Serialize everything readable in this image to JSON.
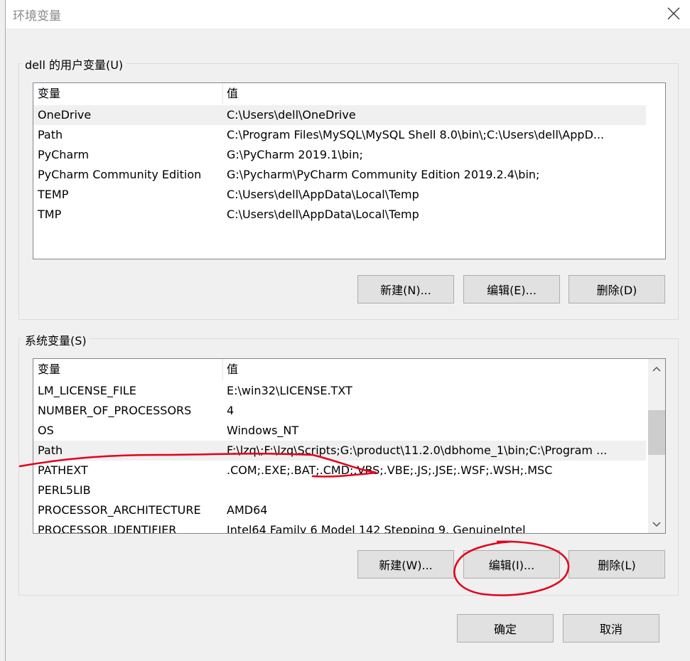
{
  "window": {
    "title": "环境变量"
  },
  "user_vars": {
    "group_label": "dell 的用户变量(U)",
    "headers": {
      "variable": "变量",
      "value": "值"
    },
    "rows": [
      {
        "variable": "OneDrive",
        "value": "C:\\Users\\dell\\OneDrive"
      },
      {
        "variable": "Path",
        "value": "C:\\Program Files\\MySQL\\MySQL Shell 8.0\\bin\\;C:\\Users\\dell\\AppD..."
      },
      {
        "variable": "PyCharm",
        "value": "G:\\PyCharm 2019.1\\bin;"
      },
      {
        "variable": "PyCharm Community Edition",
        "value": "G:\\Pycharm\\PyCharm Community Edition 2019.2.4\\bin;"
      },
      {
        "variable": "TEMP",
        "value": "C:\\Users\\dell\\AppData\\Local\\Temp"
      },
      {
        "variable": "TMP",
        "value": "C:\\Users\\dell\\AppData\\Local\\Temp"
      }
    ],
    "buttons": {
      "new": "新建(N)...",
      "edit": "编辑(E)...",
      "delete": "删除(D)"
    }
  },
  "system_vars": {
    "group_label": "系统变量(S)",
    "headers": {
      "variable": "变量",
      "value": "值"
    },
    "rows": [
      {
        "variable": "LM_LICENSE_FILE",
        "value": "E:\\win32\\LICENSE.TXT"
      },
      {
        "variable": "NUMBER_OF_PROCESSORS",
        "value": "4"
      },
      {
        "variable": "OS",
        "value": "Windows_NT"
      },
      {
        "variable": "Path",
        "value": "F:\\lzq\\;F:\\lzq\\Scripts;G:\\product\\11.2.0\\dbhome_1\\bin;C:\\Program ..."
      },
      {
        "variable": "PATHEXT",
        "value": ".COM;.EXE;.BAT;.CMD;.VBS;.VBE;.JS;.JSE;.WSF;.WSH;.MSC"
      },
      {
        "variable": "PERL5LIB",
        "value": ""
      },
      {
        "variable": "PROCESSOR_ARCHITECTURE",
        "value": "AMD64"
      },
      {
        "variable": "PROCESSOR_IDENTIFIER",
        "value": "Intel64 Family 6 Model 142 Stepping 9, GenuineIntel"
      }
    ],
    "buttons": {
      "new": "新建(W)...",
      "edit": "编辑(I)...",
      "delete": "删除(L)"
    }
  },
  "footer": {
    "ok": "确定",
    "cancel": "取消"
  },
  "colors": {
    "annotation": "#e3001b",
    "selected_row": "#f0f0f0"
  },
  "icons": {
    "close": "close-icon",
    "scroll_up": "chevron-up-icon",
    "scroll_down": "chevron-down-icon"
  }
}
